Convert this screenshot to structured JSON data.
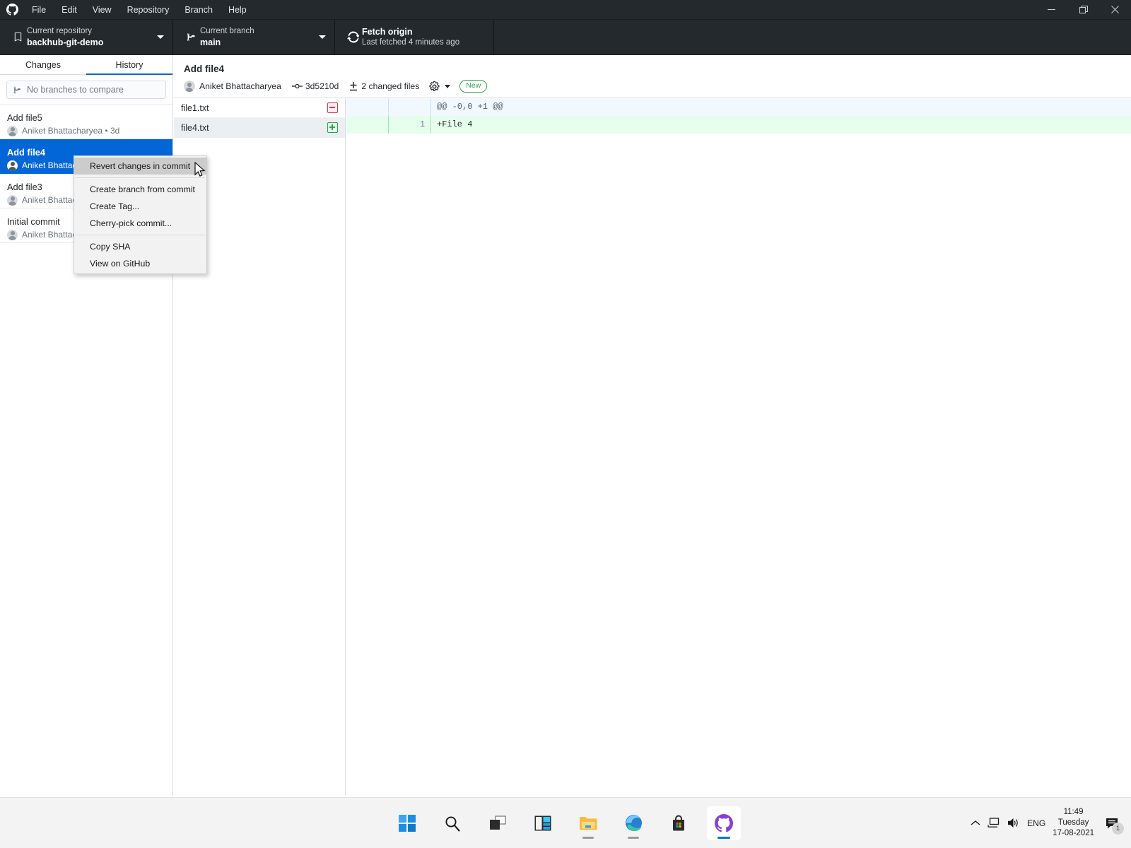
{
  "window": {
    "menus": [
      "File",
      "Edit",
      "View",
      "Repository",
      "Branch",
      "Help"
    ],
    "controls": {
      "minimize": "minimize",
      "restore": "restore",
      "close": "close"
    }
  },
  "toolbar": {
    "repository": {
      "label": "Current repository",
      "value": "backhub-git-demo"
    },
    "branch": {
      "label": "Current branch",
      "value": "main"
    },
    "fetch": {
      "title": "Fetch origin",
      "subtitle": "Last fetched 4 minutes ago"
    }
  },
  "sidebar": {
    "tabs": [
      {
        "label": "Changes",
        "active": false
      },
      {
        "label": "History",
        "active": true
      }
    ],
    "compare_placeholder": "No branches to compare",
    "commits": [
      {
        "summary": "Add file5",
        "author": "Aniket Bhattacharyea • 3d",
        "selected": false
      },
      {
        "summary": "Add file4",
        "author": "Aniket Bhattacharyea",
        "selected": true
      },
      {
        "summary": "Add file3",
        "author": "Aniket Bhattacharyea",
        "selected": false
      },
      {
        "summary": "Initial commit",
        "author": "Aniket Bhattacharyea",
        "selected": false
      }
    ]
  },
  "commit_detail": {
    "title": "Add file4",
    "author": "Aniket Bhattacharyea",
    "sha": "3d5210d",
    "changed_files": "2 changed files",
    "badge": "New"
  },
  "files": [
    {
      "name": "file1.txt",
      "status": "deleted",
      "selected": false
    },
    {
      "name": "file4.txt",
      "status": "added",
      "selected": true
    }
  ],
  "diff": {
    "lines": [
      {
        "type": "hunk",
        "old_num": "",
        "new_num": "",
        "text": "@@ -0,0 +1 @@"
      },
      {
        "type": "added",
        "old_num": "",
        "new_num": "1",
        "text": "+File 4"
      }
    ]
  },
  "context_menu": {
    "items": [
      {
        "label": "Revert changes in commit",
        "highlighted": true,
        "separator_after": true
      },
      {
        "label": "Create branch from commit",
        "highlighted": false,
        "separator_after": false
      },
      {
        "label": "Create Tag...",
        "highlighted": false,
        "separator_after": false
      },
      {
        "label": "Cherry-pick commit...",
        "highlighted": false,
        "separator_after": true
      },
      {
        "label": "Copy SHA",
        "highlighted": false,
        "separator_after": false
      },
      {
        "label": "View on GitHub",
        "highlighted": false,
        "separator_after": false
      }
    ]
  },
  "taskbar": {
    "apps": [
      {
        "name": "start-button",
        "running": false,
        "active": false
      },
      {
        "name": "search-icon",
        "running": false,
        "active": false
      },
      {
        "name": "task-view-icon",
        "running": false,
        "active": false
      },
      {
        "name": "widgets-icon",
        "running": false,
        "active": false
      },
      {
        "name": "file-explorer-icon",
        "running": true,
        "active": false
      },
      {
        "name": "microsoft-edge-icon",
        "running": true,
        "active": false
      },
      {
        "name": "microsoft-store-icon",
        "running": false,
        "active": false
      },
      {
        "name": "github-desktop-icon",
        "running": true,
        "active": true
      }
    ],
    "tray": {
      "language": "ENG",
      "time": "11:49",
      "day": "Tuesday",
      "date": "17-08-2021",
      "notification_count": "1"
    }
  },
  "colors": {
    "toolbar_bg": "#24292e",
    "accent": "#0366d6",
    "added": "#28a745",
    "deleted": "#d73a49",
    "badge_green": "#2ea44f"
  }
}
